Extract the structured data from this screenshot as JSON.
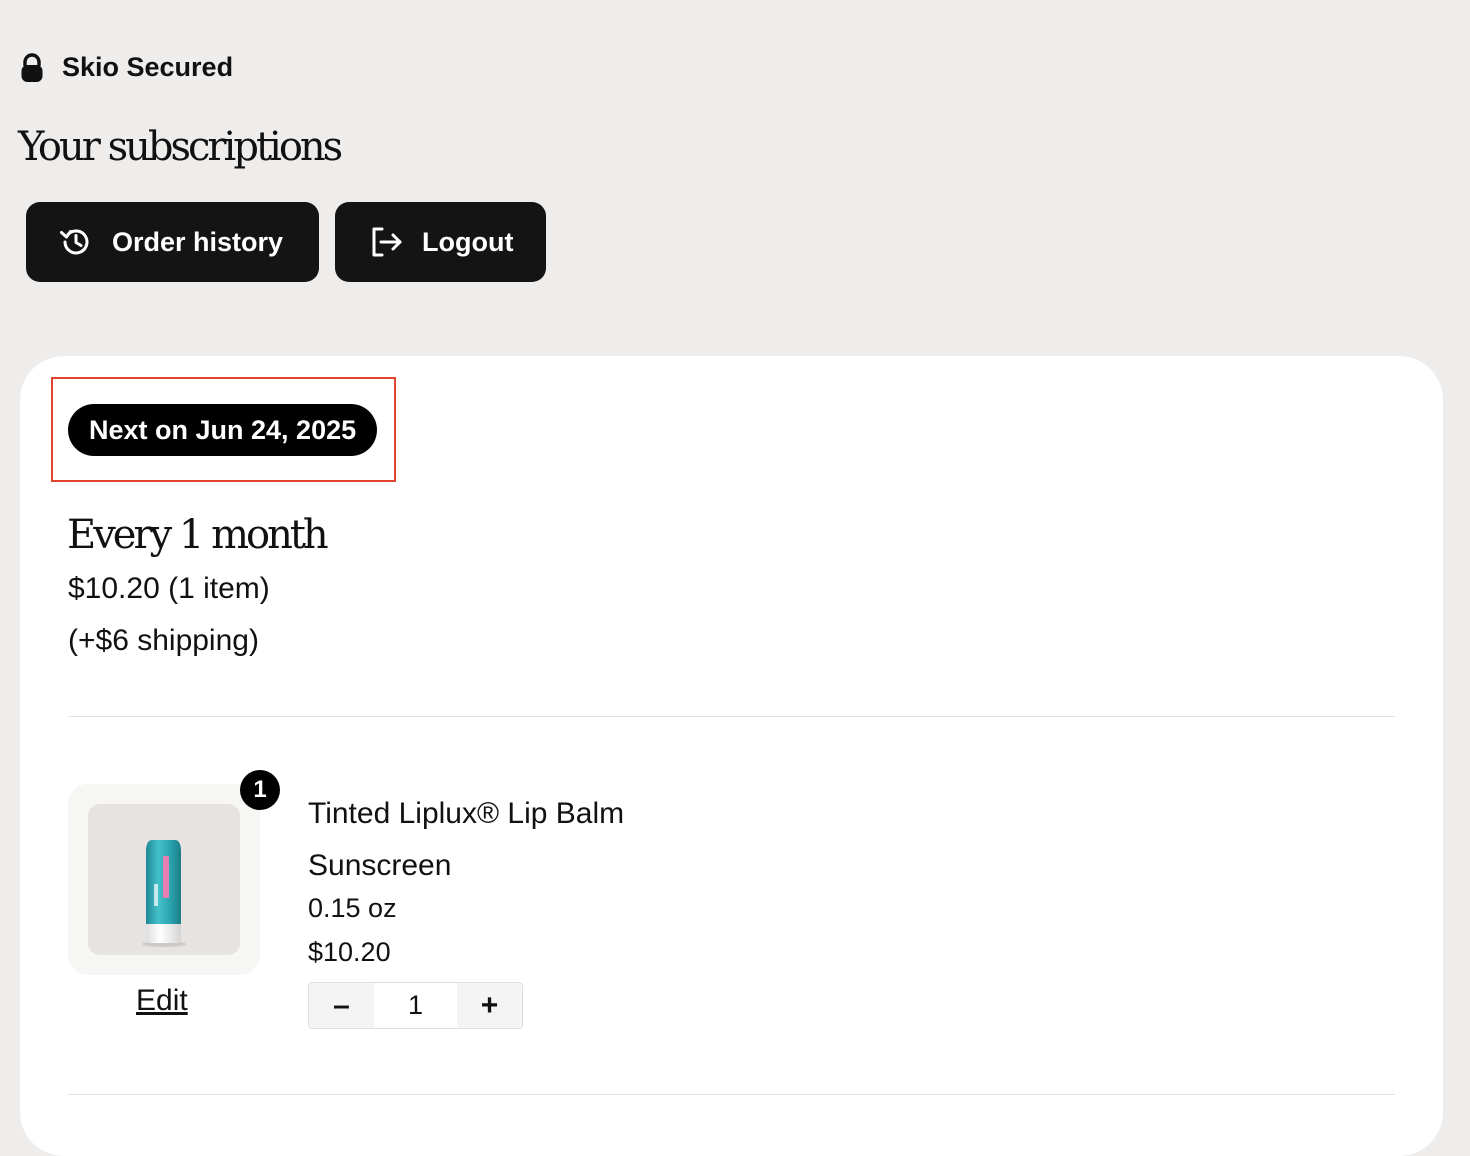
{
  "header": {
    "secured_label": "Skio Secured",
    "secured_icon": "lock-icon",
    "title": "Your subscriptions"
  },
  "actions": {
    "order_history": {
      "label": "Order history",
      "icon": "history-icon"
    },
    "logout": {
      "label": "Logout",
      "icon": "logout-icon"
    }
  },
  "subscription": {
    "next_label": "Next on Jun 24, 2025",
    "frequency": "Every 1 month",
    "price_summary": "$10.20 (1 item)",
    "shipping": "(+$6 shipping)",
    "item": {
      "quantity_badge": "1",
      "name": "Tinted Liplux® Lip Balm Sunscreen",
      "size": "0.15 oz",
      "price": "$10.20",
      "edit_label": "Edit",
      "quantity": "1",
      "decrement_symbol": "–",
      "increment_symbol": "+"
    }
  },
  "colors": {
    "background": "#eeedeb",
    "button": "#141414",
    "highlight": "#e0452f",
    "product_teal": "#2fa8b4"
  }
}
